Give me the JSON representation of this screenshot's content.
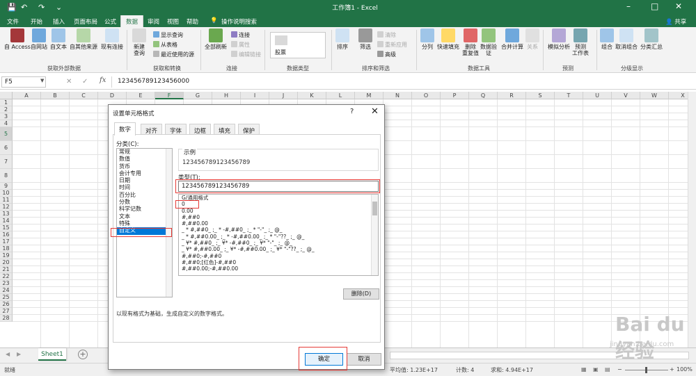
{
  "window": {
    "title": "工作簿1 - Excel",
    "min": "–",
    "max": "□",
    "close": "✕"
  },
  "qat": {
    "save": "💾",
    "undo": "↶",
    "redo": "↷",
    "more": "⌄"
  },
  "tabs": [
    "文件",
    "开始",
    "插入",
    "页面布局",
    "公式",
    "数据",
    "审阅",
    "视图",
    "帮助",
    "操作说明搜索"
  ],
  "active_tab": "数据",
  "share": "共享",
  "ribbon": {
    "ext": {
      "access": "自 Access",
      "web": "自网站",
      "text": "自文本",
      "other": "自其他来源",
      "existing": "现有连接",
      "label": "获取外部数据"
    },
    "transform": {
      "new_query": "新建\n查询",
      "show_queries": "显示查询",
      "from_table": "从表格",
      "recent": "最近使用的源",
      "label": "获取和转换"
    },
    "conn": {
      "refresh": "全部刷新",
      "connections": "连接",
      "properties": "属性",
      "edit_links": "编辑链接",
      "label": "连接"
    },
    "types": {
      "stocks": "股票",
      "label": "数据类型"
    },
    "sort": {
      "sort": "排序",
      "filter": "筛选",
      "clear": "清除",
      "reapply": "重新应用",
      "advanced": "高级",
      "label": "排序和筛选"
    },
    "tools": {
      "split": "分列",
      "flash": "快速填充",
      "dedupe": "删除\n重复值",
      "validate": "数据验\n证",
      "consolidate": "合并计算",
      "relations": "关系",
      "label": "数据工具"
    },
    "forecast": {
      "whatif": "模拟分析",
      "sheet": "预测\n工作表",
      "label": "预测"
    },
    "outline": {
      "group": "组合",
      "ungroup": "取消组合",
      "subtotal": "分类汇总",
      "label": "分级显示"
    }
  },
  "formula_bar": {
    "name_box": "F5",
    "fx": "fx",
    "cancel": "✕",
    "enter": "✓",
    "content": "123456789123456000"
  },
  "grid": {
    "columns": [
      "A",
      "B",
      "C",
      "D",
      "E",
      "F",
      "G",
      "H",
      "I",
      "J",
      "K",
      "L",
      "M",
      "N",
      "O",
      "P",
      "Q",
      "R",
      "S",
      "T",
      "U",
      "V",
      "W",
      "X"
    ],
    "rows": [
      "1",
      "2",
      "3",
      "4",
      "5",
      "6",
      "7",
      "8",
      "9",
      "10",
      "11",
      "12",
      "13",
      "14",
      "15",
      "16",
      "17",
      "18",
      "19",
      "20",
      "21",
      "22",
      "23",
      "24",
      "25",
      "26",
      "27",
      "28"
    ],
    "selected_col": "F",
    "selected_row": "5"
  },
  "sheet": {
    "name": "Sheet1",
    "add": "+"
  },
  "status": {
    "ready": "就绪",
    "average": "平均值: 1.23E+17",
    "count": "计数: 4",
    "sum": "求和: 4.94E+17",
    "zoom": "100%"
  },
  "dialog": {
    "title": "设置单元格格式",
    "help": "?",
    "close": "✕",
    "tabs": [
      "数字",
      "对齐",
      "字体",
      "边框",
      "填充",
      "保护"
    ],
    "active_tab": "数字",
    "category_label": "分类(C):",
    "categories": [
      "常规",
      "数值",
      "货币",
      "会计专用",
      "日期",
      "时间",
      "百分比",
      "分数",
      "科学记数",
      "文本",
      "特殊",
      "自定义"
    ],
    "selected_category": "自定义",
    "sample_label": "示例",
    "sample_value": "123456789123456789",
    "type_label": "类型(T):",
    "type_value": "123456789123456789",
    "formats": [
      "G/通用格式",
      "0",
      "0.00",
      "#,##0",
      "#,##0.00",
      "_ * #,##0_ ;_ * -#,##0_ ;_ * \"-\"_ ;_ @_",
      "_ * #,##0.00_ ;_ * -#,##0.00_ ;_ * \"-\"??_ ;_ @_",
      "_ ¥* #,##0_ ;_ ¥* -#,##0_ ;_ ¥* \"-\"_ ;_ @_",
      "_ ¥* #,##0.00_ ;_ ¥* -#,##0.00_ ;_ ¥* \"-\"??_ ;_ @_",
      "#,##0;-#,##0",
      "#,##0;[红色]-#,##0",
      "#,##0.00;-#,##0.00"
    ],
    "delete_label": "删除(D)",
    "description": "以现有格式为基础，生成自定义的数字格式。",
    "ok_label": "确定",
    "cancel_label": "取消"
  },
  "watermark": {
    "brand": "Bai du 经验",
    "url": "jingyan.baidu.com"
  },
  "colors": {
    "excel_green": "#217346",
    "highlight_red": "#e53935",
    "selection_blue": "#0078d7"
  }
}
